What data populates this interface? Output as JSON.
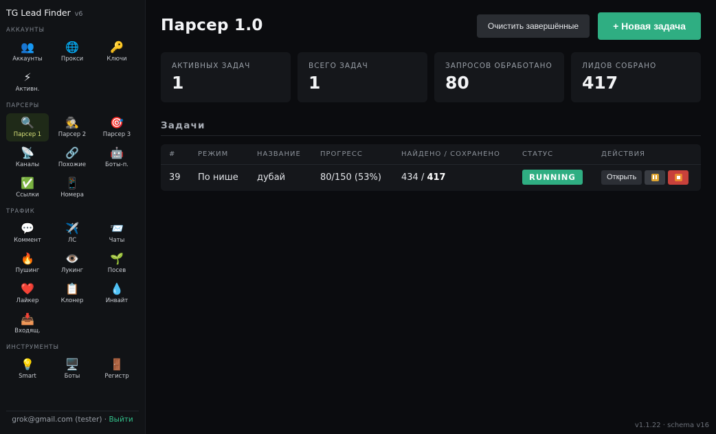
{
  "sidebar": {
    "brand": "TG Lead Finder",
    "brand_version": "v6",
    "sections": [
      {
        "label": "Аккаунты",
        "items": [
          {
            "icon": "👥",
            "label": "Аккаунты",
            "icon_name": "users-icon"
          },
          {
            "icon": "🌐",
            "label": "Прокси",
            "icon_name": "globe-icon"
          },
          {
            "icon": "🔑",
            "label": "Ключи",
            "icon_name": "key-icon"
          },
          {
            "icon": "⚡",
            "label": "Активн.",
            "icon_name": "lightning-icon"
          }
        ]
      },
      {
        "label": "Парсеры",
        "items": [
          {
            "icon": "🔍",
            "label": "Парсер 1",
            "icon_name": "magnifier-icon",
            "active": true
          },
          {
            "icon": "🕵️",
            "label": "Парсер 2",
            "icon_name": "detective-icon"
          },
          {
            "icon": "🎯",
            "label": "Парсер 3",
            "icon_name": "target-icon"
          },
          {
            "icon": "📡",
            "label": "Каналы",
            "icon_name": "antenna-icon"
          },
          {
            "icon": "🔗",
            "label": "Похожие",
            "icon_name": "link-icon"
          },
          {
            "icon": "🤖",
            "label": "Боты-п.",
            "icon_name": "robot-icon"
          },
          {
            "icon": "✅",
            "label": "Ссылки",
            "icon_name": "check-icon"
          },
          {
            "icon": "📱",
            "label": "Номера",
            "icon_name": "phone-icon"
          }
        ]
      },
      {
        "label": "Трафик",
        "items": [
          {
            "icon": "💬",
            "label": "Коммент",
            "icon_name": "speech-bubble-icon"
          },
          {
            "icon": "✈️",
            "label": "ЛС",
            "icon_name": "airplane-icon"
          },
          {
            "icon": "📨",
            "label": "Чаты",
            "icon_name": "envelope-icon"
          },
          {
            "icon": "🔥",
            "label": "Пушинг",
            "icon_name": "fire-icon"
          },
          {
            "icon": "👁️",
            "label": "Лукинг",
            "icon_name": "eye-icon"
          },
          {
            "icon": "🌱",
            "label": "Посев",
            "icon_name": "seedling-icon"
          },
          {
            "icon": "❤️",
            "label": "Лайкер",
            "icon_name": "heart-icon"
          },
          {
            "icon": "📋",
            "label": "Клонер",
            "icon_name": "clipboard-icon"
          },
          {
            "icon": "💧",
            "label": "Инвайт",
            "icon_name": "droplet-icon"
          },
          {
            "icon": "📥",
            "label": "Входящ.",
            "icon_name": "inbox-icon"
          }
        ]
      },
      {
        "label": "Инструменты",
        "items": [
          {
            "icon": "💡",
            "label": "Smart",
            "icon_name": "lightbulb-icon"
          },
          {
            "icon": "🖥️",
            "label": "Боты",
            "icon_name": "desktop-icon"
          },
          {
            "icon": "🚪",
            "label": "Регистр",
            "icon_name": "door-icon"
          }
        ]
      }
    ],
    "footer": {
      "user": "grok@gmail.com (tester)",
      "separator": "·",
      "logout": "Выйти"
    }
  },
  "header": {
    "title": "Парсер 1.0",
    "clear_button": "Очистить завершённые",
    "new_task_button": "+ Новая задача"
  },
  "stats": [
    {
      "label": "Активных задач",
      "value": "1"
    },
    {
      "label": "Всего задач",
      "value": "1"
    },
    {
      "label": "Запросов обработано",
      "value": "80"
    },
    {
      "label": "Лидов собрано",
      "value": "417"
    }
  ],
  "tasks": {
    "title": "Задачи",
    "columns": [
      "#",
      "Режим",
      "Название",
      "Прогресс",
      "Найдено / Сохранено",
      "Статус",
      "Действия"
    ],
    "rows": [
      {
        "id": "39",
        "mode": "По нише",
        "name": "дубай",
        "progress": "80/150 (53%)",
        "found": "434 /",
        "saved": "417",
        "status": "RUNNING",
        "open_button": "Открыть"
      }
    ]
  },
  "version": "v1.1.22 · schema v16",
  "colors": {
    "accent": "#2fae82",
    "danger": "#c8413b",
    "background": "#0b0c0f",
    "sidebar": "#111316",
    "card": "#15171b"
  }
}
